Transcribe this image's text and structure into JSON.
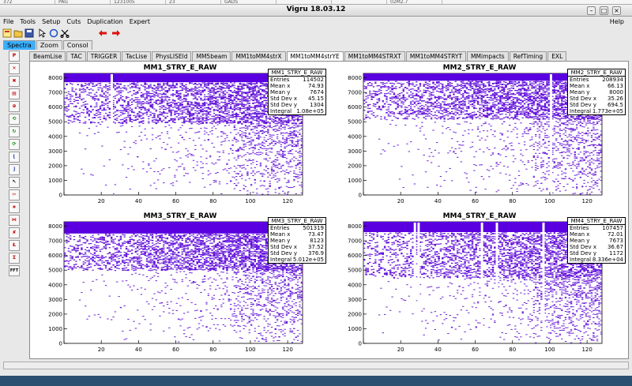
{
  "background_window": {
    "cells": [
      "372",
      "PAG",
      "1231005",
      "23",
      "GADS",
      "",
      "",
      "02M2.7"
    ]
  },
  "window": {
    "title": "Vigru 18.03.12"
  },
  "menubar": {
    "items": [
      "File",
      "Tools",
      "Setup",
      "Cuts",
      "Duplication",
      "Expert"
    ],
    "help": "Help"
  },
  "toolbar": {
    "icons": [
      "new-canvas-icon",
      "open-folder-icon",
      "save-icon",
      "arrow-cursor-icon",
      "circle-icon",
      "scissors-icon",
      "arrow-left-icon",
      "arrow-right-icon"
    ]
  },
  "main_tabs": [
    {
      "label": "Spectra",
      "active": true
    },
    {
      "label": "Zoom",
      "active": false
    },
    {
      "label": "Consol",
      "active": false
    }
  ],
  "sub_tabs": [
    {
      "label": "BeamLise",
      "active": false
    },
    {
      "label": "TAC",
      "active": false
    },
    {
      "label": "TRIGGER",
      "active": false
    },
    {
      "label": "TacLise",
      "active": false
    },
    {
      "label": "PhysLISEld",
      "active": false
    },
    {
      "label": "MM5beam",
      "active": false
    },
    {
      "label": "MM1toMM4strX",
      "active": false
    },
    {
      "label": "MM1toMM4strYE",
      "active": true
    },
    {
      "label": "MM1toMM4STRXT",
      "active": false
    },
    {
      "label": "MM1toMM4STRYT",
      "active": false
    },
    {
      "label": "MMimpacts",
      "active": false
    },
    {
      "label": "RefTiming",
      "active": false
    },
    {
      "label": "EXL",
      "active": false
    }
  ],
  "side_buttons": [
    "P",
    "",
    "",
    "",
    "",
    "",
    "",
    "",
    "",
    "",
    "",
    "",
    "",
    "",
    "",
    "",
    "",
    "FFT"
  ],
  "colors": {
    "accent": "#3ab0ff",
    "histogram": "#6a1fd8",
    "histogram_dense": "#5a00e0"
  },
  "chart_data": [
    {
      "type": "heatmap",
      "title": "MM1_STRY_E_RAW",
      "xlim": [
        0,
        128
      ],
      "ylim": [
        0,
        8300
      ],
      "xticks": [
        "0",
        "20",
        "40",
        "60",
        "80",
        "100",
        "120"
      ],
      "yticks": [
        "0",
        "1000",
        "2000",
        "3000",
        "4000",
        "5000",
        "6000",
        "7000",
        "8000"
      ],
      "stats": {
        "name": "MM1_STRY_E_RAW",
        "Entries": "114502",
        "Mean x": "74.93",
        "Mean y": "7674",
        "Std Dev x": "45.15",
        "Std Dev y": "1304",
        "Integral": "1.08e+05"
      },
      "gap_columns": [
        25
      ],
      "density": {
        "saturation_band": [
          7700,
          8300
        ],
        "dense_floor": 4900
      }
    },
    {
      "type": "heatmap",
      "title": "MM2_STRY_E_RAW",
      "xlim": [
        0,
        128
      ],
      "ylim": [
        0,
        8300
      ],
      "xticks": [
        "0",
        "20",
        "40",
        "60",
        "80",
        "100",
        "120"
      ],
      "yticks": [
        "0",
        "1000",
        "2000",
        "3000",
        "4000",
        "5000",
        "6000",
        "7000",
        "8000"
      ],
      "stats": {
        "name": "MM2_STRY_E_RAW",
        "Entries": "208934",
        "Mean x": "66.13",
        "Mean y": "8000",
        "Std Dev x": "35.26",
        "Std Dev y": "694.5",
        "Integral": "1.773e+05"
      },
      "gap_columns": [
        100
      ],
      "density": {
        "saturation_band": [
          7800,
          8300
        ],
        "dense_floor": 5200
      }
    },
    {
      "type": "heatmap",
      "title": "MM3_STRY_E_RAW",
      "xlim": [
        0,
        128
      ],
      "ylim": [
        0,
        8300
      ],
      "xticks": [
        "0",
        "20",
        "40",
        "60",
        "80",
        "100",
        "120"
      ],
      "yticks": [
        "0",
        "1000",
        "2000",
        "3000",
        "4000",
        "5000",
        "6000",
        "7000",
        "8000"
      ],
      "stats": {
        "name": "MM3_STRY_E_RAW",
        "Entries": "501319",
        "Mean x": "73.47",
        "Mean y": "8123",
        "Std Dev x": "37.52",
        "Std Dev y": "376.9",
        "Integral": "5.012e+05"
      },
      "gap_columns": [],
      "density": {
        "saturation_band": [
          7500,
          8300
        ],
        "dense_floor": 5000
      }
    },
    {
      "type": "heatmap",
      "title": "MM4_STRY_E_RAW",
      "xlim": [
        0,
        128
      ],
      "ylim": [
        0,
        8300
      ],
      "xticks": [
        "0",
        "20",
        "40",
        "60",
        "80",
        "100",
        "120"
      ],
      "yticks": [
        "0",
        "1000",
        "2000",
        "3000",
        "4000",
        "5000",
        "6000",
        "7000",
        "8000"
      ],
      "stats": {
        "name": "MM4_STRY_E_RAW",
        "Entries": "107457",
        "Mean x": "72.01",
        "Mean y": "7673",
        "Std Dev x": "36.67",
        "Std Dev y": "1172",
        "Integral": "8.336e+04"
      },
      "gap_columns": [
        27,
        29,
        63,
        71,
        96
      ],
      "density": {
        "saturation_band": [
          7600,
          8300
        ],
        "dense_floor": 4500
      }
    }
  ]
}
